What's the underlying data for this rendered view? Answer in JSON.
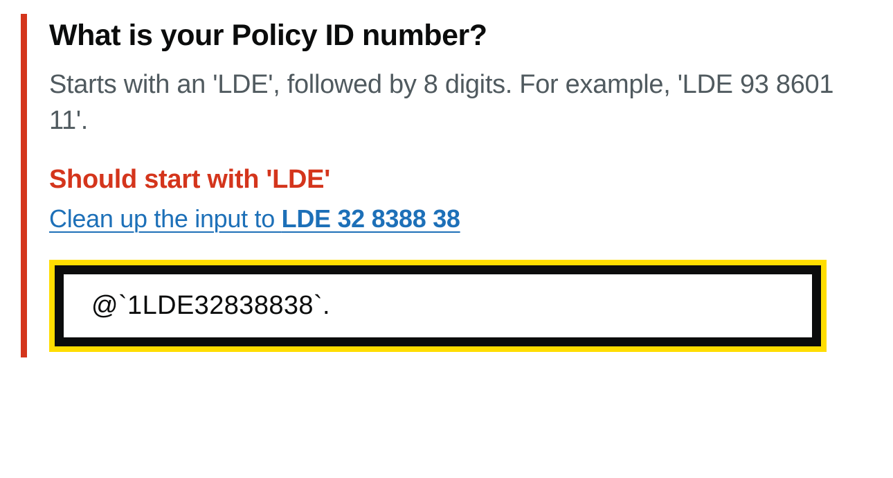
{
  "form": {
    "legend": "What is your Policy ID number?",
    "hint": "Starts with an 'LDE', followed by 8 digits. For example, 'LDE 93 8601 11'.",
    "error": "Should start with 'LDE'",
    "suggestion_prefix": "Clean up the input to ",
    "suggestion_value": "LDE 32 8388 38",
    "input_value": "@`1LDE32838838`."
  }
}
